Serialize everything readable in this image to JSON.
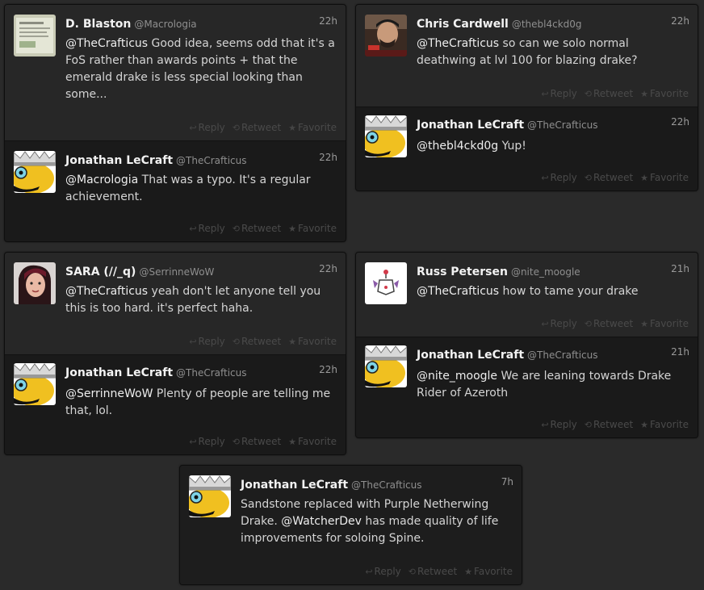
{
  "colors": {
    "page_bg": "#2a2a2a",
    "card_bg": "#1d1d1d",
    "name": "#f2f2f2",
    "text": "#d4d4d4",
    "muted": "#8f8f8f",
    "action": "#4a4a4a"
  },
  "actions": {
    "reply": "Reply",
    "retweet": "Retweet",
    "favorite": "Favorite"
  },
  "icons": {
    "reply": "reply-arrow-icon",
    "retweet": "retweet-loop-icon",
    "favorite": "star-icon"
  },
  "conversations": [
    {
      "tweets": [
        {
          "name": "D. Blaston",
          "handle": "@Macrologia",
          "time": "22h",
          "avatar": "screenshot-thumbnail",
          "mention": "@TheCrafticus",
          "text": " Good idea, seems odd that it's a FoS rather than awards points + that the emerald drake is less special looking than some..."
        },
        {
          "name": "Jonathan LeCraft",
          "handle": "@TheCrafticus",
          "time": "22h",
          "avatar": "crowned-smiley",
          "mention": "@Macrologia",
          "text": " That was a typo. It's a regular achievement."
        }
      ]
    },
    {
      "tweets": [
        {
          "name": "Chris Cardwell",
          "handle": "@thebl4ckd0g",
          "time": "22h",
          "avatar": "person-photo",
          "mention": "@TheCrafticus",
          "text": " so can we solo normal deathwing at lvl 100 for blazing drake?"
        },
        {
          "name": "Jonathan LeCraft",
          "handle": "@TheCrafticus",
          "time": "22h",
          "avatar": "crowned-smiley",
          "mention": "@thebl4ckd0g",
          "text": " Yup!"
        }
      ]
    },
    {
      "tweets": [
        {
          "name": "SARA (//_q)",
          "handle": "@SerrinneWoW",
          "time": "22h",
          "avatar": "woman-photo",
          "mention": "@TheCrafticus",
          "text": " yeah don't let anyone tell you this is too hard. it's perfect haha."
        },
        {
          "name": "Jonathan LeCraft",
          "handle": "@TheCrafticus",
          "time": "22h",
          "avatar": "crowned-smiley",
          "mention": "@SerrinneWoW",
          "text": " Plenty of people are telling me that, lol."
        }
      ]
    },
    {
      "tweets": [
        {
          "name": "Russ Petersen",
          "handle": "@nite_moogle",
          "time": "21h",
          "avatar": "moogle-logo",
          "mention": "@TheCrafticus",
          "text": " how to tame your drake"
        },
        {
          "name": "Jonathan LeCraft",
          "handle": "@TheCrafticus",
          "time": "21h",
          "avatar": "crowned-smiley",
          "mention": "@nite_moogle",
          "text": " We are leaning towards Drake Rider of Azeroth"
        }
      ]
    },
    {
      "tweets": [
        {
          "name": "Jonathan LeCraft",
          "handle": "@TheCrafticus",
          "time": "7h",
          "avatar": "crowned-smiley",
          "text_before": "Sandstone replaced with Purple Netherwing Drake. ",
          "mention": "@WatcherDev",
          "text": " has made quality of life improvements for soloing Spine."
        }
      ]
    }
  ]
}
